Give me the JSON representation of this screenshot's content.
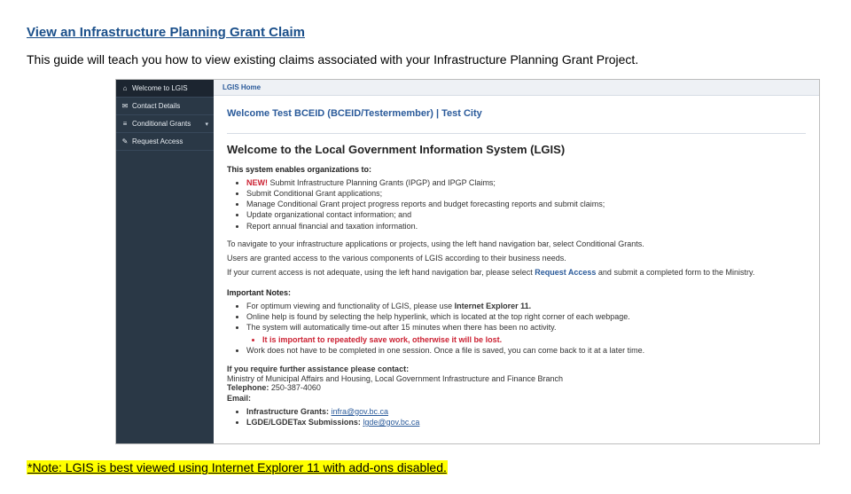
{
  "guide": {
    "title": "View an Infrastructure Planning Grant Claim",
    "intro": "This guide will teach you how to view existing claims associated with your Infrastructure Planning Grant Project.",
    "note": "*Note: LGIS is best viewed using Internet Explorer 11 with add-ons disabled."
  },
  "shot": {
    "sidebar": {
      "items": [
        {
          "icon": "⌂",
          "label": "Welcome to LGIS"
        },
        {
          "icon": "✉",
          "label": "Contact Details"
        },
        {
          "icon": "≡",
          "label": "Conditional Grants"
        },
        {
          "icon": "✎",
          "label": "Request Access"
        }
      ]
    },
    "breadcrumb": "LGIS Home",
    "welcome_user": "Welcome Test BCEID (BCEID/Testermember) | Test City",
    "welcome_system": "Welcome to the Local Government Information System (LGIS)",
    "enables_heading": "This system enables organizations to:",
    "enables": {
      "new_flag": "NEW!",
      "new_text": " Submit Infrastructure Planning Grants (IPGP) and IPGP Claims;",
      "i2": "Submit Conditional Grant applications;",
      "i3": "Manage Conditional Grant project progress reports and budget forecasting reports and submit claims;",
      "i4": "Update organizational contact information; and",
      "i5": "Report annual financial and taxation information."
    },
    "paras": {
      "p1": "To navigate to your infrastructure applications or projects, using the left hand navigation bar, select Conditional Grants.",
      "p2": "Users are granted access to the various components of LGIS according to their business needs.",
      "p3a": "If your current access is not adequate, using the left hand navigation bar, please select ",
      "p3link": "Request Access",
      "p3b": " and submit a completed form to the Ministry."
    },
    "notes_heading": "Important Notes:",
    "notes": {
      "n1a": "For optimum viewing and functionality of LGIS, please use ",
      "n1b": "Internet Explorer 11.",
      "n2": "Online help is found by selecting the help hyperlink, which is located at the top right corner of each webpage.",
      "n3": "The system will automatically time-out after 15 minutes when there has been no activity.",
      "n3warn": "It is important to repeatedly save work, otherwise it will be lost.",
      "n4": "Work does not have to be completed in one session.  Once a file is saved, you can come back to it at a later time."
    },
    "contact": {
      "heading": "If you require further assistance please contact:",
      "ministry": "Ministry of Municipal Affairs and Housing, Local Government Infrastructure and Finance Branch",
      "phone_label": "Telephone:",
      "phone": " 250-387-4060",
      "email_label": "Email:",
      "emails": {
        "e1_label": "Infrastructure Grants: ",
        "e1_link": "infra@gov.bc.ca",
        "e2_label": "LGDE/LGDETax Submissions: ",
        "e2_link": "lgde@gov.bc.ca"
      }
    }
  }
}
